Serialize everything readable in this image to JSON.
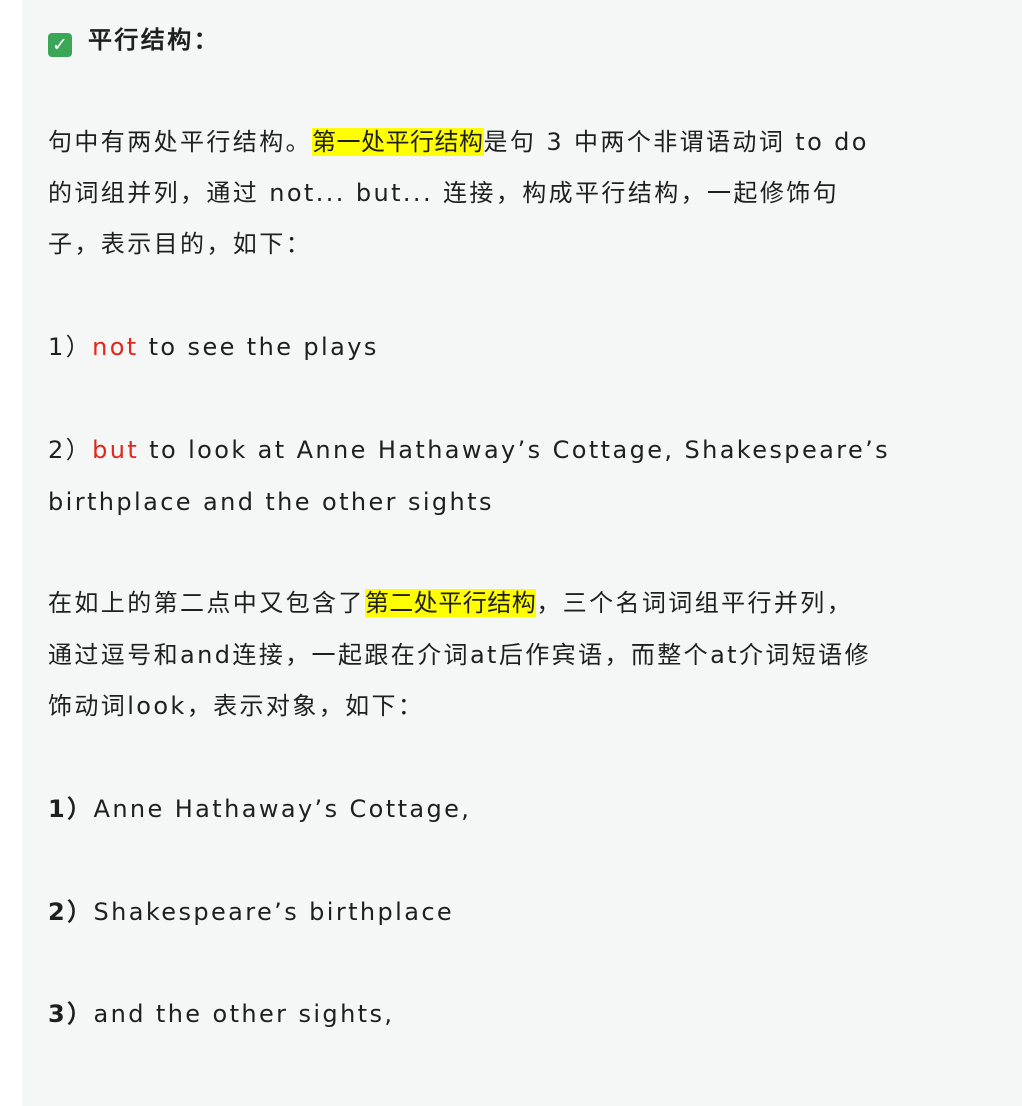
{
  "section_title": {
    "icon": "check-mark-icon",
    "icon_glyph": "✓",
    "text": "平行结构："
  },
  "paragraph1": {
    "line1_pre": "句中有两处平行结构。",
    "line1_highlight": "第一处平行结构",
    "line1_post": "是句 3 中两个非谓语动词 to do",
    "line2": "的词组并列，通过 not... but... 连接，构成平行结构，一起修饰句",
    "line3": "子，表示目的，如下："
  },
  "list1": [
    {
      "num": "1）",
      "keyword": "not",
      "rest": " to see the plays"
    },
    {
      "num": "2）",
      "keyword": "but",
      "rest": " to look at Anne Hathaway’s Cottage, Shakespeare’s",
      "cont": "birthplace and the other sights"
    }
  ],
  "paragraph2": {
    "line1_pre": "在如上的第二点中又包含了",
    "line1_highlight": "第二处平行结构",
    "line1_post": "，三个名词词组平行并列，",
    "line2": "通过逗号和and连接，一起跟在介词at后作宾语，而整个at介词短语修",
    "line3": "饰动词look，表示对象，如下："
  },
  "list2": [
    {
      "num": "1）",
      "text": "Anne Hathaway’s Cottage,"
    },
    {
      "num": "2）",
      "text": "Shakespeare’s birthplace"
    },
    {
      "num": "3）",
      "text": "and the other sights,"
    }
  ],
  "colors": {
    "highlight": "#ffff00",
    "keyword_red": "#e2261b",
    "check_green": "#3aa757",
    "card_background": "#f4f7f6"
  }
}
